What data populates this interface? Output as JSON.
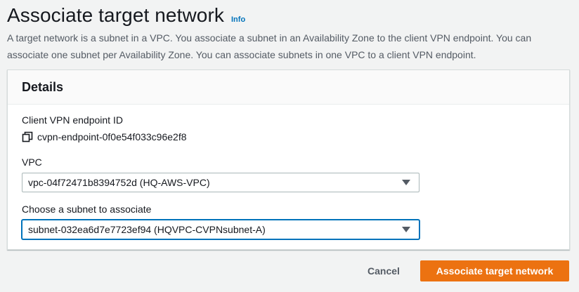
{
  "header": {
    "title": "Associate target network",
    "info_link": "Info",
    "description": "A target network is a subnet in a VPC. You associate a subnet in an Availability Zone to the client VPN endpoint. You can associate one subnet per Availability Zone. You can associate subnets in one VPC to a client VPN endpoint."
  },
  "details": {
    "title": "Details",
    "endpoint": {
      "label": "Client VPN endpoint ID",
      "value": "cvpn-endpoint-0f0e54f033c96e2f8",
      "icon": "copy-icon"
    },
    "vpc": {
      "label": "VPC",
      "selected": "vpc-04f72471b8394752d (HQ-AWS-VPC)"
    },
    "subnet": {
      "label": "Choose a subnet to associate",
      "selected": "subnet-032ea6d7e7723ef94 (HQVPC-CVPNsubnet-A)"
    }
  },
  "actions": {
    "cancel_label": "Cancel",
    "submit_label": "Associate target network"
  },
  "colors": {
    "primary_button": "#ec7211",
    "link": "#0073bb",
    "focus_border": "#0073bb"
  }
}
